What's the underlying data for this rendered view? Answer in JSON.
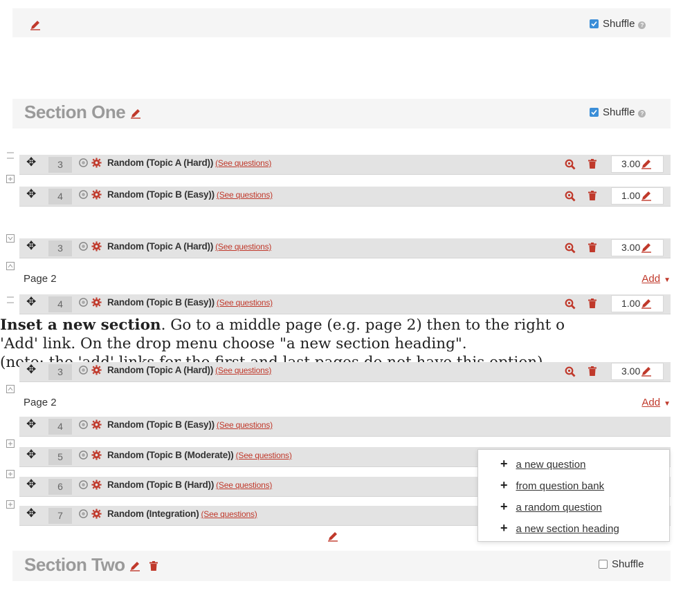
{
  "colors": {
    "accent": "#c0392b",
    "checkbox": "#3b8ed8",
    "row_bg": "#e3e3e3",
    "section_bg": "#f5f5f5",
    "section_title": "#9a9a9a"
  },
  "icons": {
    "move": "move-icon",
    "random": "random-question-icon",
    "gear": "gear-icon",
    "preview": "search-icon",
    "delete": "trash-icon",
    "edit": "pencil-icon",
    "page_break": "page-break-icon",
    "help": "help-icon",
    "add": "plus-icon",
    "caret": "chevron-down-icon"
  },
  "top_section": {
    "shuffle_label": "Shuffle",
    "shuffle_checked": true
  },
  "section_one": {
    "title": "Section One",
    "shuffle_label": "Shuffle",
    "shuffle_checked": true
  },
  "group1": {
    "rows": [
      {
        "slot": "3",
        "name": "Random (Topic A (Hard))",
        "see": "(See questions)",
        "mark": "3.00"
      },
      {
        "slot": "4",
        "name": "Random (Topic B (Easy))",
        "see": "(See questions)",
        "mark": "1.00"
      }
    ]
  },
  "group2": {
    "rows": [
      {
        "slot": "3",
        "name": "Random (Topic A (Hard))",
        "see": "(See questions)",
        "mark": "3.00"
      },
      {
        "slot": "4",
        "name": "Random (Topic B (Easy))",
        "see": "(See questions)",
        "mark": "1.00"
      }
    ],
    "page_label": "Page 2",
    "add_label": "Add"
  },
  "instructions": {
    "bold": "Inset a new section",
    "line1_rest": ". Go to a middle page (e.g. page 2) then to the right o",
    "line2": "'Add' link. On the drop menu choose \"a new section heading\".",
    "line3": "(note: the 'add' links for the first and last pages do not have this option)."
  },
  "group3": {
    "rows": [
      {
        "slot": "3",
        "name": "Random (Topic A (Hard))",
        "see": "(See questions)",
        "mark": "3.00"
      },
      {
        "slot": "4",
        "name": "Random (Topic B (Easy))",
        "see": "(See questions)"
      },
      {
        "slot": "5",
        "name": "Random (Topic B (Moderate))",
        "see": "(See questions)"
      },
      {
        "slot": "6",
        "name": "Random (Topic B (Hard))",
        "see": "(See questions)"
      },
      {
        "slot": "7",
        "name": "Random (Integration)",
        "see": "(See questions)"
      }
    ],
    "page_label": "Page 2",
    "add_label": "Add"
  },
  "add_menu": {
    "items": [
      {
        "label": "a new question"
      },
      {
        "label": "from question bank"
      },
      {
        "label": "a random question"
      },
      {
        "label": "a new section heading"
      }
    ]
  },
  "section_two": {
    "title": "Section Two",
    "shuffle_label": "Shuffle",
    "shuffle_checked": false
  }
}
